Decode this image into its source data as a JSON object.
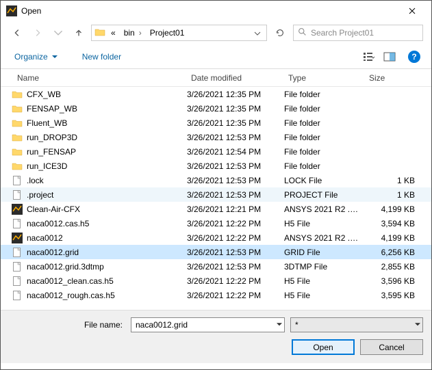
{
  "window": {
    "title": "Open"
  },
  "nav": {
    "breadcrumb_prefix": "«",
    "crumbs": [
      "bin",
      "Project01"
    ],
    "search_placeholder": "Search Project01"
  },
  "toolbar": {
    "organize": "Organize",
    "new_folder": "New folder"
  },
  "columns": {
    "name": "Name",
    "date": "Date modified",
    "type": "Type",
    "size": "Size"
  },
  "files": [
    {
      "icon": "folder",
      "name": "CFX_WB",
      "date": "3/26/2021 12:35 PM",
      "type": "File folder",
      "size": "",
      "state": ""
    },
    {
      "icon": "folder",
      "name": "FENSAP_WB",
      "date": "3/26/2021 12:35 PM",
      "type": "File folder",
      "size": "",
      "state": ""
    },
    {
      "icon": "folder",
      "name": "Fluent_WB",
      "date": "3/26/2021 12:35 PM",
      "type": "File folder",
      "size": "",
      "state": ""
    },
    {
      "icon": "folder",
      "name": "run_DROP3D",
      "date": "3/26/2021 12:53 PM",
      "type": "File folder",
      "size": "",
      "state": ""
    },
    {
      "icon": "folder",
      "name": "run_FENSAP",
      "date": "3/26/2021 12:54 PM",
      "type": "File folder",
      "size": "",
      "state": ""
    },
    {
      "icon": "folder",
      "name": "run_ICE3D",
      "date": "3/26/2021 12:53 PM",
      "type": "File folder",
      "size": "",
      "state": ""
    },
    {
      "icon": "doc",
      "name": ".lock",
      "date": "3/26/2021 12:53 PM",
      "type": "LOCK File",
      "size": "1 KB",
      "state": ""
    },
    {
      "icon": "doc",
      "name": ".project",
      "date": "3/26/2021 12:53 PM",
      "type": "PROJECT File",
      "size": "1 KB",
      "state": "soft"
    },
    {
      "icon": "ansys",
      "name": "Clean-Air-CFX",
      "date": "3/26/2021 12:21 PM",
      "type": "ANSYS 2021 R2 .cf...",
      "size": "4,199 KB",
      "state": ""
    },
    {
      "icon": "doc",
      "name": "naca0012.cas.h5",
      "date": "3/26/2021 12:22 PM",
      "type": "H5 File",
      "size": "3,594 KB",
      "state": ""
    },
    {
      "icon": "ansys",
      "name": "naca0012",
      "date": "3/26/2021 12:22 PM",
      "type": "ANSYS 2021 R2 .cf...",
      "size": "4,199 KB",
      "state": ""
    },
    {
      "icon": "doc",
      "name": "naca0012.grid",
      "date": "3/26/2021 12:53 PM",
      "type": "GRID File",
      "size": "6,256 KB",
      "state": "selected"
    },
    {
      "icon": "doc",
      "name": "naca0012.grid.3dtmp",
      "date": "3/26/2021 12:53 PM",
      "type": "3DTMP File",
      "size": "2,855 KB",
      "state": ""
    },
    {
      "icon": "doc",
      "name": "naca0012_clean.cas.h5",
      "date": "3/26/2021 12:22 PM",
      "type": "H5 File",
      "size": "3,596 KB",
      "state": ""
    },
    {
      "icon": "doc",
      "name": "naca0012_rough.cas.h5",
      "date": "3/26/2021 12:22 PM",
      "type": "H5 File",
      "size": "3,595 KB",
      "state": ""
    }
  ],
  "footer": {
    "filename_label": "File name:",
    "filename_value": "naca0012.grid",
    "filter_value": "*",
    "open": "Open",
    "cancel": "Cancel"
  }
}
